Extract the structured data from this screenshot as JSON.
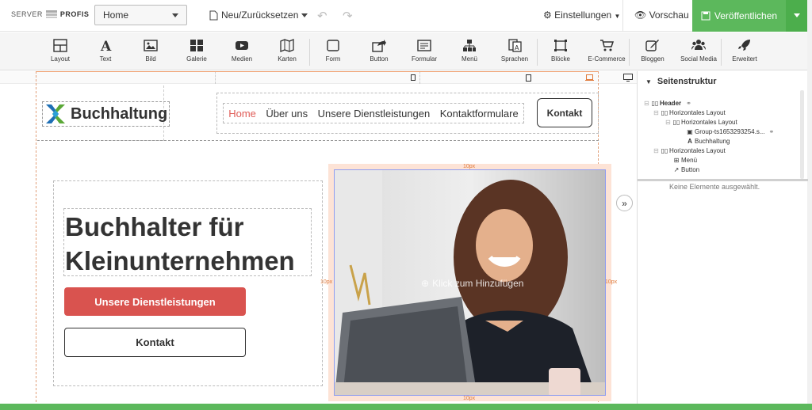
{
  "topbar": {
    "logo_left": "SERVER",
    "logo_right": "PROFIS",
    "page_select": "Home",
    "new_reset": "Neu/Zurücksetzen",
    "settings": "Einstellungen",
    "preview": "Vorschau",
    "publish": "Veröffentlichen"
  },
  "toolbar": {
    "items": [
      {
        "label": "Layout",
        "icon": "layout-icon"
      },
      {
        "label": "Text",
        "icon": "text-icon"
      },
      {
        "label": "Bild",
        "icon": "image-icon"
      },
      {
        "label": "Galerie",
        "icon": "gallery-icon"
      },
      {
        "label": "Medien",
        "icon": "video-icon"
      },
      {
        "label": "Karten",
        "icon": "map-icon"
      },
      {
        "label": "Form",
        "icon": "shape-icon"
      },
      {
        "label": "Button",
        "icon": "button-icon"
      },
      {
        "label": "Formular",
        "icon": "form-icon"
      },
      {
        "label": "Menü",
        "icon": "sitemap-icon"
      },
      {
        "label": "Sprachen",
        "icon": "language-icon"
      },
      {
        "label": "Blöcke",
        "icon": "blocks-icon"
      },
      {
        "label": "E-Commerce",
        "icon": "cart-icon"
      },
      {
        "label": "Bloggen",
        "icon": "blog-icon"
      },
      {
        "label": "Social Media",
        "icon": "users-icon"
      },
      {
        "label": "Erweitert",
        "icon": "rocket-icon"
      }
    ]
  },
  "site": {
    "brand": "Buchhaltung",
    "nav": [
      "Home",
      "Über uns",
      "Unsere Dienstleistungen",
      "Kontaktformulare"
    ],
    "nav_button": "Kontakt",
    "hero_title": "Buchhalter für Kleinunternehmen",
    "btn_primary": "Unsere Dienstleistungen",
    "btn_secondary": "Kontakt",
    "click_to_add": "Klick zum Hinzufügen",
    "padding_label": "10px"
  },
  "panel": {
    "title": "Seitenstruktur",
    "tree": [
      {
        "label": "Header",
        "icon": "columns-icon",
        "bold": true
      },
      {
        "label": "Horizontales Layout",
        "icon": "columns-icon"
      },
      {
        "label": "Horizontales Layout",
        "icon": "columns-icon"
      },
      {
        "label": "Group-ts1653293254.s...",
        "icon": "image-icon"
      },
      {
        "label": "Buchhaltung",
        "icon": "text-icon"
      },
      {
        "label": "Horizontales Layout",
        "icon": "columns-icon"
      },
      {
        "label": "Menü",
        "icon": "sitemap-icon"
      },
      {
        "label": "Button",
        "icon": "button-icon"
      }
    ],
    "no_selection": "Keine Elemente ausgewählt."
  },
  "colors": {
    "publish_green": "#5cb85c",
    "accent_red": "#d9534f",
    "nav_active": "#e05c57",
    "padding_orange": "#e07a3b"
  }
}
